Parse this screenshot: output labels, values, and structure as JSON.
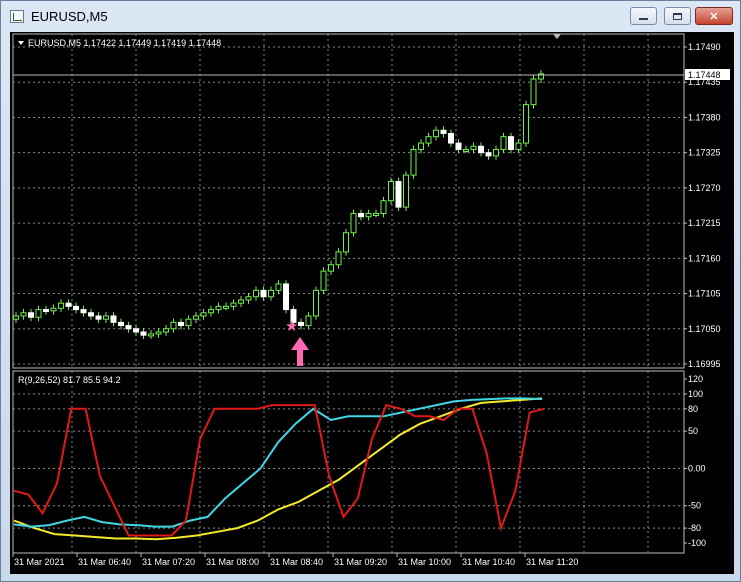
{
  "window": {
    "title": "EURUSD,M5"
  },
  "main_panel": {
    "header_label": "EURUSD,M5  1.17422 1.17449 1.17419 1.17448",
    "price_ticks": [
      "1.17490",
      "1.17435",
      "1.17380",
      "1.17325",
      "1.17270",
      "1.17215",
      "1.17160",
      "1.17105",
      "1.17050",
      "1.16995"
    ],
    "current_price": "1.17448",
    "candle_color": "#6ef04a"
  },
  "indicator_panel": {
    "header_label": "R(9,26,52) 81.7 85.5 94.2",
    "ticks": [
      "120",
      "100",
      "80",
      "50",
      "0.00",
      "-50",
      "-80",
      "-100"
    ],
    "line_colors": {
      "red": "#e11919",
      "cyan": "#3fd6e8",
      "yellow": "#f2ea2a"
    }
  },
  "x_axis": {
    "labels": [
      "31 Mar 2021",
      "31 Mar 06:40",
      "31 Mar 07:20",
      "31 Mar 08:00",
      "31 Mar 08:40",
      "31 Mar 09:20",
      "31 Mar 10:00",
      "31 Mar 10:40",
      "31 Mar 11:20"
    ]
  },
  "markers": {
    "star_color": "#ff69b4",
    "arrow_color": "#ff69b4"
  },
  "chart_data": {
    "type": "line",
    "title": "EURUSD,M5",
    "price_series": {
      "name": "EURUSD",
      "close": [
        1.1707,
        1.17075,
        1.17068,
        1.1708,
        1.17078,
        1.17082,
        1.1709,
        1.17085,
        1.1708,
        1.17075,
        1.1707,
        1.17065,
        1.1707,
        1.1706,
        1.17055,
        1.1705,
        1.17045,
        1.1704,
        1.17042,
        1.17045,
        1.1705,
        1.1706,
        1.17055,
        1.17065,
        1.1707,
        1.17075,
        1.1708,
        1.17085,
        1.17085,
        1.1709,
        1.17095,
        1.171,
        1.1711,
        1.171,
        1.1711,
        1.1712,
        1.1708,
        1.1706,
        1.17055,
        1.1707,
        1.1711,
        1.1714,
        1.1715,
        1.1717,
        1.172,
        1.1723,
        1.17225,
        1.1723,
        1.1723,
        1.1725,
        1.1728,
        1.1724,
        1.1729,
        1.1733,
        1.1734,
        1.1735,
        1.1736,
        1.17355,
        1.1734,
        1.1733,
        1.1733,
        1.17335,
        1.17325,
        1.1732,
        1.1733,
        1.1735,
        1.1733,
        1.1734,
        1.174,
        1.1744,
        1.17448
      ],
      "ylim": [
        1.16995,
        1.1749
      ]
    },
    "indicator_series": [
      {
        "name": "red",
        "values": [
          -30,
          -35,
          -60,
          -20,
          80,
          80,
          -10,
          -50,
          -90,
          -90,
          -90,
          -90,
          -70,
          40,
          80,
          80,
          80,
          80,
          85,
          85,
          85,
          85,
          -10,
          -65,
          -40,
          40,
          85,
          80,
          70,
          70,
          65,
          80,
          80,
          20,
          -80,
          -30,
          75,
          80
        ]
      },
      {
        "name": "cyan",
        "values": [
          -75,
          -78,
          -76,
          -70,
          -65,
          -72,
          -75,
          -76,
          -78,
          -78,
          -70,
          -65,
          -40,
          -20,
          0,
          35,
          60,
          80,
          65,
          70,
          70,
          70,
          75,
          80,
          85,
          90,
          92,
          93,
          94,
          94,
          93
        ]
      },
      {
        "name": "yellow",
        "values": [
          -70,
          -80,
          -88,
          -90,
          -92,
          -94,
          -94,
          -95,
          -93,
          -90,
          -85,
          -80,
          -70,
          -55,
          -45,
          -30,
          -15,
          5,
          25,
          45,
          60,
          70,
          80,
          88,
          90,
          92,
          94
        ]
      }
    ],
    "indicator_ylim": [
      -100,
      120
    ]
  }
}
